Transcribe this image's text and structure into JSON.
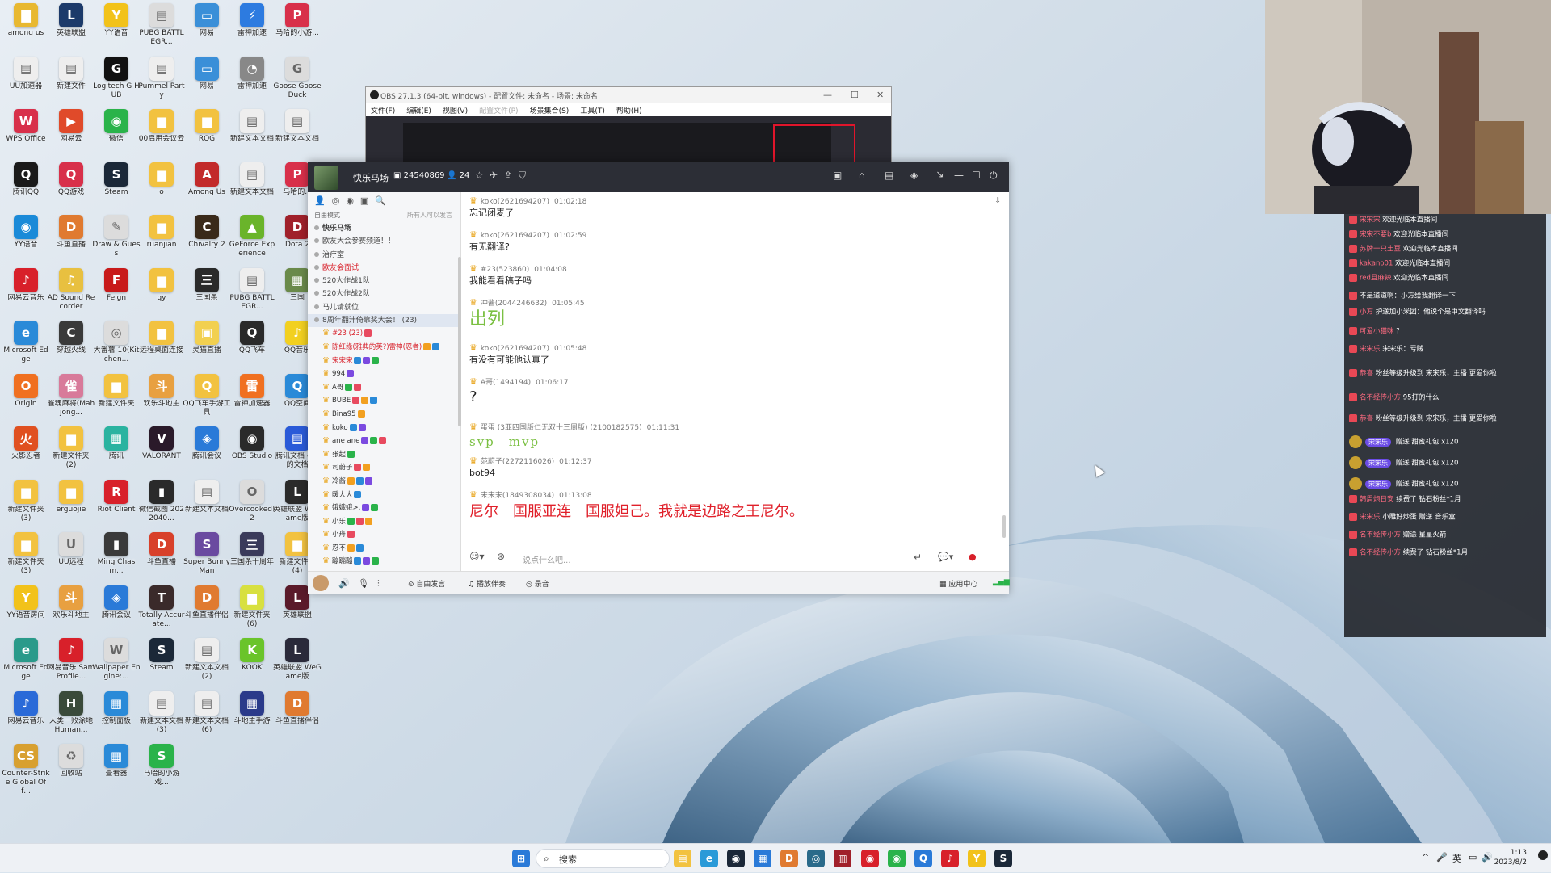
{
  "desktop_icons": [
    {
      "label": "among us",
      "color": "#e8b830",
      "glyph": "▇"
    },
    {
      "label": "英雄联盟",
      "color": "#1c3a6a",
      "glyph": "L"
    },
    {
      "label": "YY语音",
      "color": "#f2c21a",
      "glyph": "Y"
    },
    {
      "label": "PUBG BATTLEGR...",
      "color": "#dcdcdc",
      "glyph": "▤"
    },
    {
      "label": "网易",
      "color": "#3a8fd8",
      "glyph": "▭"
    },
    {
      "label": "雷神加速",
      "color": "#2d7be0",
      "glyph": "⚡"
    },
    {
      "label": "马哈的小游...",
      "color": "#d8304a",
      "glyph": "P"
    },
    {
      "label": "UU加速器",
      "color": "#eeeeee",
      "glyph": "▤"
    },
    {
      "label": "新建文件",
      "color": "#eeeeee",
      "glyph": "▤"
    },
    {
      "label": "Logitech G HUB",
      "color": "#111111",
      "glyph": "G"
    },
    {
      "label": "Pummel Party",
      "color": "#eeeeee",
      "glyph": "▤"
    },
    {
      "label": "网易",
      "color": "#3a8fd8",
      "glyph": "▭"
    },
    {
      "label": "雷神加速",
      "color": "#888888",
      "glyph": "◔"
    },
    {
      "label": "Goose Goose Duck",
      "color": "#dcdcdc",
      "glyph": "G"
    },
    {
      "label": "WPS Office",
      "color": "#d8304a",
      "glyph": "W"
    },
    {
      "label": "网易云",
      "color": "#e04a2a",
      "glyph": "▶"
    },
    {
      "label": "微信",
      "color": "#2ab34a",
      "glyph": "◉"
    },
    {
      "label": "00启用会议云",
      "color": "#f2c240",
      "glyph": "▆"
    },
    {
      "label": "ROG",
      "color": "#f2c240",
      "glyph": "▆"
    },
    {
      "label": "新建文本文档",
      "color": "#eeeeee",
      "glyph": "▤"
    },
    {
      "label": "新建文本文档",
      "color": "#eeeeee",
      "glyph": "▤"
    },
    {
      "label": "腾讯QQ",
      "color": "#1a1a1a",
      "glyph": "Q"
    },
    {
      "label": "QQ游戏",
      "color": "#d8304a",
      "glyph": "Q"
    },
    {
      "label": "Steam",
      "color": "#1b2838",
      "glyph": "S"
    },
    {
      "label": "o",
      "color": "#f2c240",
      "glyph": "▆"
    },
    {
      "label": "Among Us",
      "color": "#c22a2a",
      "glyph": "A"
    },
    {
      "label": "新建文本文档",
      "color": "#eeeeee",
      "glyph": "▤"
    },
    {
      "label": "马哈的...",
      "color": "#d8304a",
      "glyph": "P"
    },
    {
      "label": "YY语音",
      "color": "#1a8ad8",
      "glyph": "◉"
    },
    {
      "label": "斗鱼直播",
      "color": "#e07a30",
      "glyph": "D"
    },
    {
      "label": "Draw & Guess",
      "color": "#dcdcdc",
      "glyph": "✎"
    },
    {
      "label": "ruanjian",
      "color": "#f2c240",
      "glyph": "▆"
    },
    {
      "label": "Chivalry 2",
      "color": "#3a2a1a",
      "glyph": "C"
    },
    {
      "label": "GeForce Experience",
      "color": "#6ab42a",
      "glyph": "▲"
    },
    {
      "label": "Dota 2",
      "color": "#a0202a",
      "glyph": "D"
    },
    {
      "label": "网易云音乐",
      "color": "#d8202a",
      "glyph": "♪"
    },
    {
      "label": "AD Sound Recorder",
      "color": "#e8c040",
      "glyph": "♫"
    },
    {
      "label": "Feign",
      "color": "#c81a1a",
      "glyph": "F"
    },
    {
      "label": "qy",
      "color": "#f2c240",
      "glyph": "▆"
    },
    {
      "label": "三国杀",
      "color": "#2a2a2a",
      "glyph": "三"
    },
    {
      "label": "PUBG BATTLEGR...",
      "color": "#eeeeee",
      "glyph": "▤"
    },
    {
      "label": "三国",
      "color": "#6a8a4a",
      "glyph": "▦"
    },
    {
      "label": "Microsoft Edge",
      "color": "#2a8ad8",
      "glyph": "e"
    },
    {
      "label": "穿越火线",
      "color": "#3a3a3a",
      "glyph": "C"
    },
    {
      "label": "大番薯 10(Kitchen...",
      "color": "#dcdcdc",
      "glyph": "◎"
    },
    {
      "label": "远程桌面连接",
      "color": "#f2c240",
      "glyph": "▆"
    },
    {
      "label": "灵猫直播",
      "color": "#f2d050",
      "glyph": "▣"
    },
    {
      "label": "QQ飞车",
      "color": "#2a2a2a",
      "glyph": "Q"
    },
    {
      "label": "QQ音乐",
      "color": "#f2d020",
      "glyph": "♪"
    },
    {
      "label": "Origin",
      "color": "#f07020",
      "glyph": "O"
    },
    {
      "label": "雀魂麻将(Mahjong...",
      "color": "#d87a9a",
      "glyph": "雀"
    },
    {
      "label": "新建文件夹",
      "color": "#f2c240",
      "glyph": "▆"
    },
    {
      "label": "欢乐斗地主",
      "color": "#e8a040",
      "glyph": "斗"
    },
    {
      "label": "QQ飞车手游工具",
      "color": "#f2c240",
      "glyph": "Q"
    },
    {
      "label": "雷神加速器",
      "color": "#f07020",
      "glyph": "雷"
    },
    {
      "label": "QQ空间",
      "color": "#2a8ad8",
      "glyph": "Q"
    },
    {
      "label": "火影忍者",
      "color": "#e05020",
      "glyph": "火"
    },
    {
      "label": "新建文件夹 (2)",
      "color": "#f2c240",
      "glyph": "▆"
    },
    {
      "label": "腾讯",
      "color": "#2ab3a0",
      "glyph": "▦"
    },
    {
      "label": "VALORANT",
      "color": "#2a1a2a",
      "glyph": "V"
    },
    {
      "label": "腾讯会议",
      "color": "#2a7ad8",
      "glyph": "◈"
    },
    {
      "label": "OBS Studio",
      "color": "#2a2a2a",
      "glyph": "◉"
    },
    {
      "label": "腾讯文档 - 我的文档",
      "color": "#2a5ad8",
      "glyph": "▤"
    },
    {
      "label": "新建文件夹 (3)",
      "color": "#f2c240",
      "glyph": "▆"
    },
    {
      "label": "erguojie",
      "color": "#f2c240",
      "glyph": "▆"
    },
    {
      "label": "Riot Client",
      "color": "#d8202a",
      "glyph": "R"
    },
    {
      "label": "微信截图 2022040...",
      "color": "#2a2a2a",
      "glyph": "▮"
    },
    {
      "label": "新建文本文档",
      "color": "#eeeeee",
      "glyph": "▤"
    },
    {
      "label": "Overcooked! 2",
      "color": "#dcdcdc",
      "glyph": "O"
    },
    {
      "label": "英雄联盟 WeGame版",
      "color": "#2a2a2a",
      "glyph": "L"
    },
    {
      "label": "新建文件夹 (3)",
      "color": "#f2c240",
      "glyph": "▆"
    },
    {
      "label": "UU远程",
      "color": "#dcdcdc",
      "glyph": "U"
    },
    {
      "label": "Ming Chasm...",
      "color": "#3a3a3a",
      "glyph": "▮"
    },
    {
      "label": "斗鱼直播",
      "color": "#d8402a",
      "glyph": "D"
    },
    {
      "label": "Super Bunny Man",
      "color": "#6a4aa0",
      "glyph": "S"
    },
    {
      "label": "三国杀十周年",
      "color": "#3a3a5a",
      "glyph": "三"
    },
    {
      "label": "新建文件夹 (4)",
      "color": "#f2c240",
      "glyph": "▆"
    },
    {
      "label": "YY语音房间",
      "color": "#f2c21a",
      "glyph": "Y"
    },
    {
      "label": "欢乐斗地主",
      "color": "#e8a040",
      "glyph": "斗"
    },
    {
      "label": "腾讯会议",
      "color": "#2a7ad8",
      "glyph": "◈"
    },
    {
      "label": "Totally Accurate...",
      "color": "#3a2a2a",
      "glyph": "T"
    },
    {
      "label": "斗鱼直播伴侣",
      "color": "#e07a30",
      "glyph": "D"
    },
    {
      "label": "新建文件夹 (6)",
      "color": "#d8e040",
      "glyph": "▆"
    },
    {
      "label": "英雄联盟",
      "color": "#5a1a2a",
      "glyph": "L"
    },
    {
      "label": "Microsoft Edge",
      "color": "#2a9a8a",
      "glyph": "e"
    },
    {
      "label": "网易音乐 SamProfile...",
      "color": "#d8202a",
      "glyph": "♪"
    },
    {
      "label": "Wallpaper Engine:...",
      "color": "#dcdcdc",
      "glyph": "W"
    },
    {
      "label": "Steam",
      "color": "#1b2838",
      "glyph": "S"
    },
    {
      "label": "新建文本文档 (2)",
      "color": "#eeeeee",
      "glyph": "▤"
    },
    {
      "label": "KOOK",
      "color": "#6ac42a",
      "glyph": "K"
    },
    {
      "label": "英雄联盟 WeGame版",
      "color": "#2a2a3a",
      "glyph": "L"
    },
    {
      "label": "网易云音乐",
      "color": "#2a6ad8",
      "glyph": "♪"
    },
    {
      "label": "人类一败涂地 Human...",
      "color": "#3a4a3a",
      "glyph": "H"
    },
    {
      "label": "控制面板",
      "color": "#2a8ad8",
      "glyph": "▦"
    },
    {
      "label": "新建文本文档 (3)",
      "color": "#eeeeee",
      "glyph": "▤"
    },
    {
      "label": "新建文本文档 (6)",
      "color": "#eeeeee",
      "glyph": "▤"
    },
    {
      "label": "斗地主手游",
      "color": "#2a3a8a",
      "glyph": "▦"
    },
    {
      "label": "斗鱼直播伴侣",
      "color": "#e07a30",
      "glyph": "D"
    },
    {
      "label": "Counter-Strike Global Off...",
      "color": "#d8a030",
      "glyph": "CS"
    },
    {
      "label": "回收站",
      "color": "#dcdcdc",
      "glyph": "♻"
    },
    {
      "label": "查看器",
      "color": "#2a8ad8",
      "glyph": "▦"
    },
    {
      "label": "马哈的小游戏...",
      "color": "#2ab34a",
      "glyph": "S"
    }
  ],
  "obs": {
    "title": "OBS 27.1.3 (64-bit, windows) - 配置文件: 未命名 - 场景: 未命名",
    "menu": [
      "文件(F)",
      "编辑(E)",
      "视图(V)",
      "配置文件(P)",
      "场景集合(S)",
      "工具(T)",
      "帮助(H)"
    ],
    "win_buttons": [
      "—",
      "☐",
      "✕"
    ]
  },
  "yy": {
    "channel_name": "快乐马场",
    "channel_id": "24540869",
    "online_count": "24",
    "head_icons": [
      "▣",
      "⌂",
      "▤",
      "◈",
      "⇲",
      "—",
      "☐",
      "⏻"
    ],
    "tools_icons": [
      "👤",
      "◎",
      "◉",
      "▣",
      "🔍"
    ],
    "mode_left": "自由模式",
    "mode_right": "所有人可以发言",
    "channels": [
      {
        "name": "快乐马场",
        "bold": true
      },
      {
        "name": "欧友大会参赛频道！！"
      },
      {
        "name": "治疗室"
      },
      {
        "name": "欧友会面试",
        "red": true
      },
      {
        "name": "520大作战1队"
      },
      {
        "name": "520大作战2队"
      },
      {
        "name": "马儿请就位"
      },
      {
        "name": "8周年翻汁倚靠奖大会！ (23)",
        "sel": true
      }
    ],
    "members": [
      "#23 (23)",
      "陈红缘(雅典的英?)雷神(忍者)",
      "宋宋宋",
      "994",
      "A哥",
      "BUBE",
      "Bina95",
      "koko",
      "ane ane",
      "张起",
      "司蔚子",
      "冷酱",
      "暖大大",
      "娥娥娥>.",
      "小乐",
      "小舟",
      "忍不",
      "蹦蹦蹦"
    ],
    "messages": [
      {
        "user": "koko(2621694207)",
        "time": "01:02:18",
        "text": "忘记闭麦了"
      },
      {
        "user": "koko(2621694207)",
        "time": "01:02:59",
        "text": "有无翻译?"
      },
      {
        "user": "#23(523860)",
        "time": "01:04:08",
        "text": "我能看看稿子吗"
      },
      {
        "user": "冲酱(2044246632)",
        "time": "01:05:45",
        "text": "出列",
        "big": true,
        "color": "#7bc043"
      },
      {
        "user": "koko(2621694207)",
        "time": "01:05:48",
        "text": "有没有可能他认真了"
      },
      {
        "user": "A哥(1494194)",
        "time": "01:06:17",
        "text": "?"
      },
      {
        "user": "蛋蛋 (3亚四国版仁无双十三周版) (2100182575)",
        "time": "01:11:31",
        "text": "svp　mvp",
        "green": true
      },
      {
        "user": "范蔚子(2272116026)",
        "time": "01:12:37",
        "text": "bot94"
      },
      {
        "user": "宋宋宋(1849308034)",
        "time": "01:13:08",
        "text": "尼尔　国服亚连　国服妲己。我就是边路之王尼尔。",
        "big": true,
        "color": "#e0202a"
      }
    ],
    "input_placeholder": "说点什么吧...",
    "bottom": [
      "自由发言",
      "播放伴奏",
      "录音",
      "应用中心"
    ]
  },
  "live_chat": [
    {
      "user": "宋宋宋",
      "text": "欢迎光临本直播间"
    },
    {
      "user": "宋宋不要b",
      "text": "欢迎光临本直播间"
    },
    {
      "user": "苏牌一只土豆",
      "text": "欢迎光临本直播间"
    },
    {
      "user": "kakano01",
      "text": "欢迎光临本直播间"
    },
    {
      "user": "red且麻辣",
      "text": "欢迎光临本直播间"
    },
    {
      "user": "",
      "text": "不是道道啊：小方给我翻译一下"
    },
    {
      "user": "小方",
      "text": "护送加小米团：他说个是中文翻译吗"
    },
    {
      "user": "可爱小猫咪",
      "text": "?"
    },
    {
      "user": "宋宋乐",
      "text": "宋宋乐：亏贼"
    },
    {
      "user": "恭喜",
      "text": "粉丝等级升级到 宋宋乐，主播 更爱你啦"
    },
    {
      "user": "名不经传小方",
      "text": "95打的什么"
    },
    {
      "user": "恭喜",
      "text": "粉丝等级升级到 宋宋乐，主播 更爱你啦"
    },
    {
      "user": "宋宋乐",
      "text": "赠送 甜蜜礼包 x120"
    },
    {
      "user": "宋宋乐",
      "text": "赠送 甜蜜礼包 x120"
    },
    {
      "user": "宋宋乐",
      "text": "赠送 甜蜜礼包 x120"
    },
    {
      "user": "韩周炮日安",
      "text": "续费了 钻石粉丝*1月"
    },
    {
      "user": "宋宋乐",
      "text": "小雕好炒蛋 赠送 音乐盒"
    },
    {
      "user": "名不经传小方",
      "text": "赠送 星星火箭"
    },
    {
      "user": "名不经传小方",
      "text": "续费了 钻石粉丝*1月"
    }
  ],
  "taskbar": {
    "search": "搜索",
    "apps": [
      {
        "color": "#2a7ad8",
        "glyph": "⊞"
      },
      {
        "color": "#f2c240",
        "glyph": "▤"
      },
      {
        "color": "#2a9ad8",
        "glyph": "e"
      },
      {
        "color": "#1b2838",
        "glyph": "◉"
      },
      {
        "color": "#2a7ad8",
        "glyph": "▦"
      },
      {
        "color": "#e07a30",
        "glyph": "D"
      },
      {
        "color": "#2a6a8a",
        "glyph": "◎"
      },
      {
        "color": "#a0202a",
        "glyph": "▥"
      },
      {
        "color": "#d8202a",
        "glyph": "◉"
      },
      {
        "color": "#2ab34a",
        "glyph": "◉"
      },
      {
        "color": "#2a7ad8",
        "glyph": "Q"
      },
      {
        "color": "#d8202a",
        "glyph": "♪"
      },
      {
        "color": "#f2c21a",
        "glyph": "Y"
      },
      {
        "color": "#1b2838",
        "glyph": "S"
      }
    ],
    "tray": [
      "^",
      "🎤",
      "英",
      "▭",
      "🔊"
    ],
    "time": "1:13",
    "date": "2023/8/2"
  }
}
